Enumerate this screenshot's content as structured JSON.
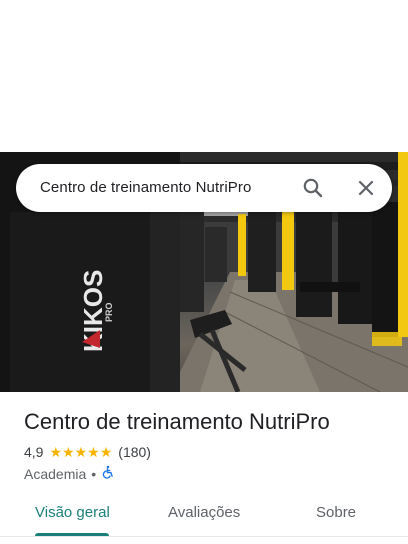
{
  "search": {
    "query": "Centro de treinamento NutriPro",
    "search_icon": "search-icon",
    "close_icon": "close-icon"
  },
  "hero": {
    "brand_text": "KIKOS",
    "brand_sub": "PRO",
    "photo_subject": "gym-interior-photo"
  },
  "place": {
    "title": "Centro de treinamento NutriPro",
    "rating": "4,9",
    "stars": 5,
    "review_count": "(180)",
    "category": "Academia",
    "separator": "•",
    "accessibility_icon": "wheelchair-accessible-icon"
  },
  "tabs": [
    {
      "label": "Visão geral",
      "active": true
    },
    {
      "label": "Avaliações",
      "active": false
    },
    {
      "label": "Sobre",
      "active": false
    }
  ],
  "colors": {
    "accent": "#1a7f7a",
    "star": "#f6b400",
    "pillar_yellow": "#f2c811",
    "accessibility_blue": "#1a73e8"
  }
}
